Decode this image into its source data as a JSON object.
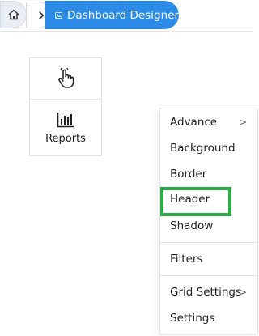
{
  "breadcrumb": {
    "home_icon": "home-icon",
    "chevron_icon": "chevron-right-icon",
    "current_icon": "image-icon",
    "current_label": "Dashboard Designer"
  },
  "tools": {
    "pointer_icon": "hand-pointer-icon",
    "reports_icon": "bar-chart-icon",
    "reports_label": "Reports"
  },
  "menu": {
    "items": [
      {
        "label": "Advance",
        "has_submenu": true
      },
      {
        "label": "Background",
        "has_submenu": false
      },
      {
        "label": "Border",
        "has_submenu": false
      },
      {
        "label": "Header",
        "has_submenu": false,
        "highlighted": true
      },
      {
        "label": "Shadow",
        "has_submenu": false
      },
      {
        "label": "Filters",
        "has_submenu": false
      },
      {
        "label": "Grid Settings",
        "has_submenu": true
      },
      {
        "label": "Settings",
        "has_submenu": false
      }
    ],
    "submenu_arrow": ">"
  },
  "colors": {
    "accent_blue": "#2b8be7",
    "highlight_green": "#2eaa4a"
  }
}
